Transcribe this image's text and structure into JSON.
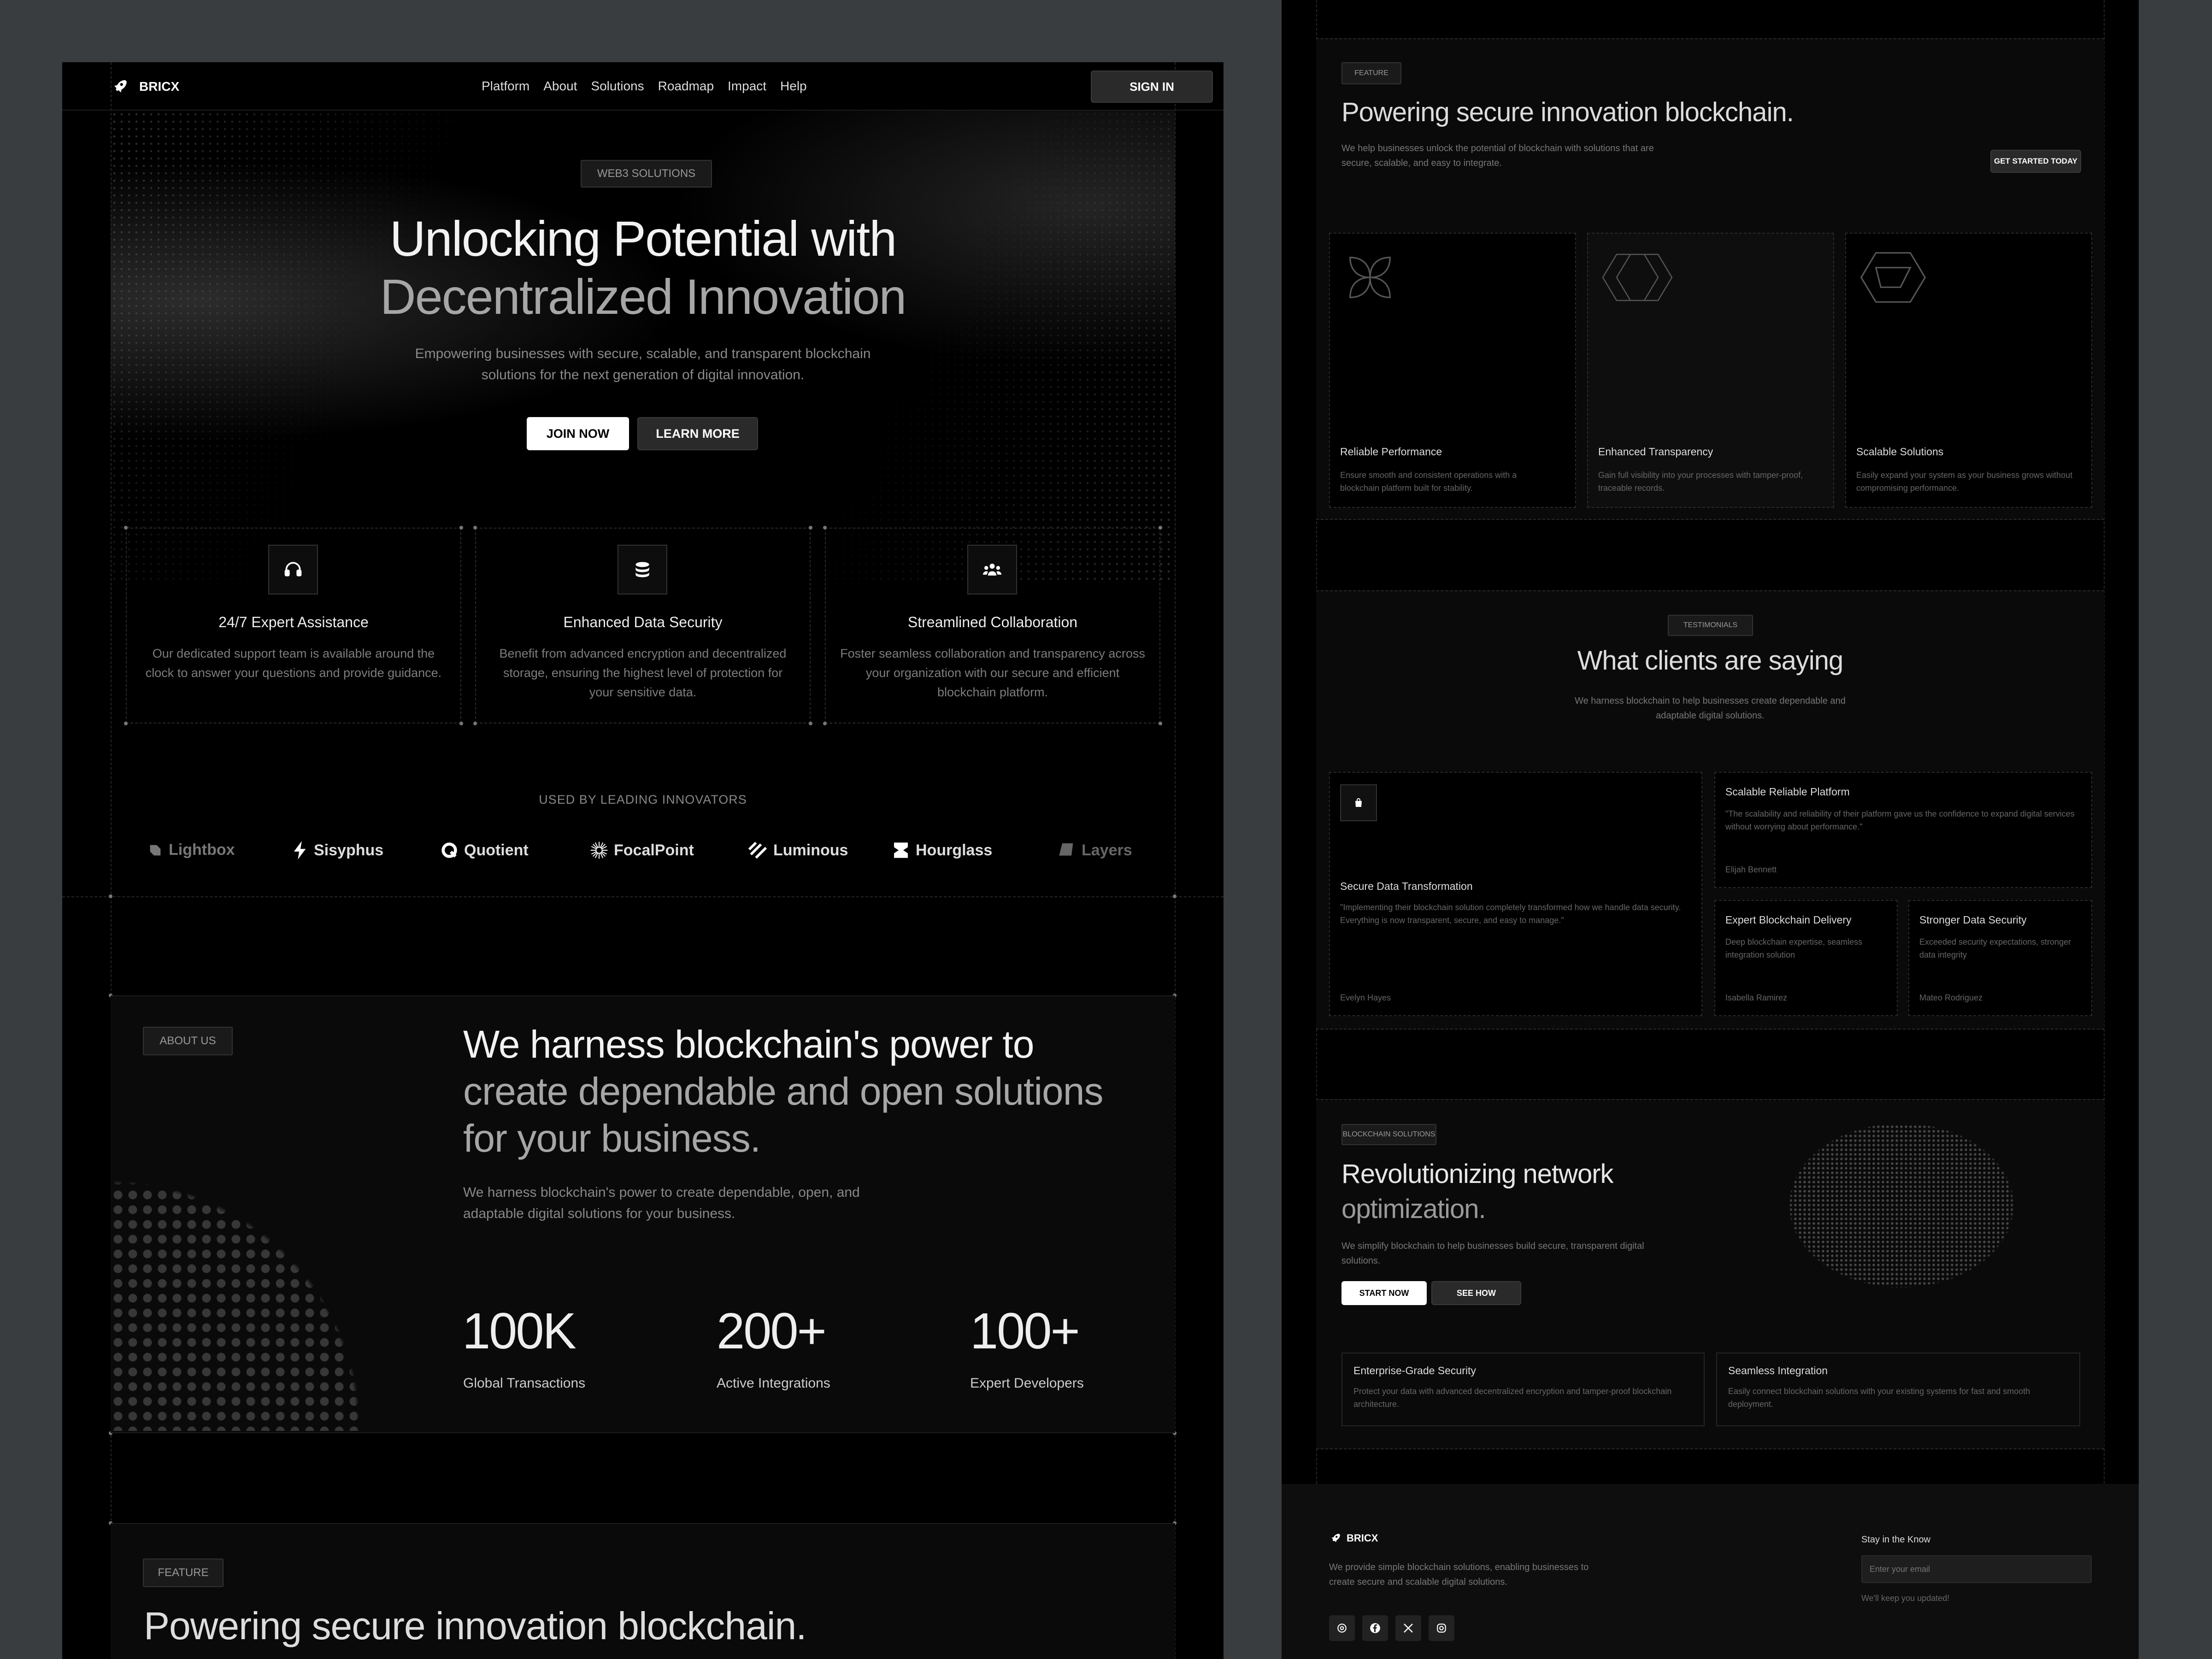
{
  "brand": {
    "name": "BRICX"
  },
  "nav": {
    "links": [
      "Platform",
      "About",
      "Solutions",
      "Roadmap",
      "Impact",
      "Help"
    ],
    "signin": "SIGN IN"
  },
  "hero": {
    "tag": "WEB3 SOLUTIONS",
    "title_line1": "Unlocking Potential with",
    "title_line2": "Decentralized Innovation",
    "subtitle": "Empowering businesses with secure, scalable, and transparent blockchain solutions for the next generation of digital innovation.",
    "join": "JOIN NOW",
    "learn": "LEARN MORE"
  },
  "features": [
    {
      "title": "24/7 Expert Assistance",
      "desc": "Our dedicated support team is available around the clock to answer your questions and provide guidance.",
      "icon": "headset-icon"
    },
    {
      "title": "Enhanced Data Security",
      "desc": "Benefit from advanced encryption and decentralized storage, ensuring the highest level of protection for your sensitive data.",
      "icon": "database-icon"
    },
    {
      "title": "Streamlined Collaboration",
      "desc": "Foster seamless collaboration and transparency across your organization with our secure and efficient blockchain platform.",
      "icon": "team-icon"
    }
  ],
  "logos": {
    "heading": "USED BY LEADING INNOVATORS",
    "items": [
      "Lightbox",
      "Sisyphus",
      "Quotient",
      "FocalPoint",
      "Luminous",
      "Hourglass",
      "Layers"
    ]
  },
  "about": {
    "tag": "ABOUT US",
    "title_white": "We harness blockchain's power to",
    "title_gray": "create dependable and open solutions for your business.",
    "subtitle": "We harness blockchain's power to create dependable, open, and adaptable digital solutions for your business.",
    "stats": [
      {
        "value": "100K",
        "label": "Global Transactions"
      },
      {
        "value": "200+",
        "label": "Active Integrations"
      },
      {
        "value": "100+",
        "label": "Expert Developers"
      }
    ]
  },
  "feature_section": {
    "tag": "FEATURE",
    "title": "Powering secure innovation blockchain.",
    "subtitle": "We help businesses unlock the potential of blockchain with solutions that are secure, scalable, and easy to integrate.",
    "cta": "GET STARTED TODAY",
    "cards": [
      {
        "title": "Reliable Performance",
        "desc": "Ensure smooth and consistent operations with a blockchain platform built for stability."
      },
      {
        "title": "Enhanced Transparency",
        "desc": "Gain full visibility into your processes with tamper-proof, traceable records."
      },
      {
        "title": "Scalable Solutions",
        "desc": "Easily expand your system as your business grows without compromising performance."
      }
    ]
  },
  "testimonials": {
    "tag": "TESTIMONIALS",
    "title": "What clients are saying",
    "subtitle": "We harness blockchain to help businesses create dependable and adaptable digital solutions.",
    "items": [
      {
        "title": "Secure Data Transformation",
        "quote": "\"Implementing their blockchain solution completely transformed how we handle data security. Everything is now transparent, secure, and easy to manage.\"",
        "author": "Evelyn Hayes"
      },
      {
        "title": "Scalable Reliable Platform",
        "quote": "\"The scalability and reliability of their platform gave us the confidence to expand digital services without worrying about performance.\"",
        "author": "Elijah Bennett"
      },
      {
        "title": "Expert Blockchain Delivery",
        "quote": "Deep blockchain expertise, seamless integration solution",
        "author": "Isabella Ramirez"
      },
      {
        "title": "Stronger Data Security",
        "quote": "Exceeded security expectations, stronger data integrity",
        "author": "Mateo Rodriguez"
      }
    ]
  },
  "solutions": {
    "tag": "BLOCKCHAIN SOLUTIONS",
    "title_white": "Revolutionizing network",
    "title_gray": "optimization.",
    "subtitle": "We simplify blockchain to help businesses build secure, transparent digital solutions.",
    "start": "START NOW",
    "see": "SEE HOW",
    "cards": [
      {
        "title": "Enterprise-Grade Security",
        "desc": "Protect your data with advanced decentralized encryption and tamper-proof blockchain architecture."
      },
      {
        "title": "Seamless Integration",
        "desc": "Easily connect blockchain solutions with your existing systems for fast and smooth deployment."
      }
    ]
  },
  "footer": {
    "brand": "BRICX",
    "desc": "We provide simple blockchain solutions, enabling businesses to create secure and scalable digital solutions.",
    "newsletter_title": "Stay in the Know",
    "email_placeholder": "Enter your email",
    "note": "We'll keep you updated!",
    "socials": [
      "threads-icon",
      "facebook-icon",
      "x-icon",
      "instagram-icon"
    ]
  }
}
